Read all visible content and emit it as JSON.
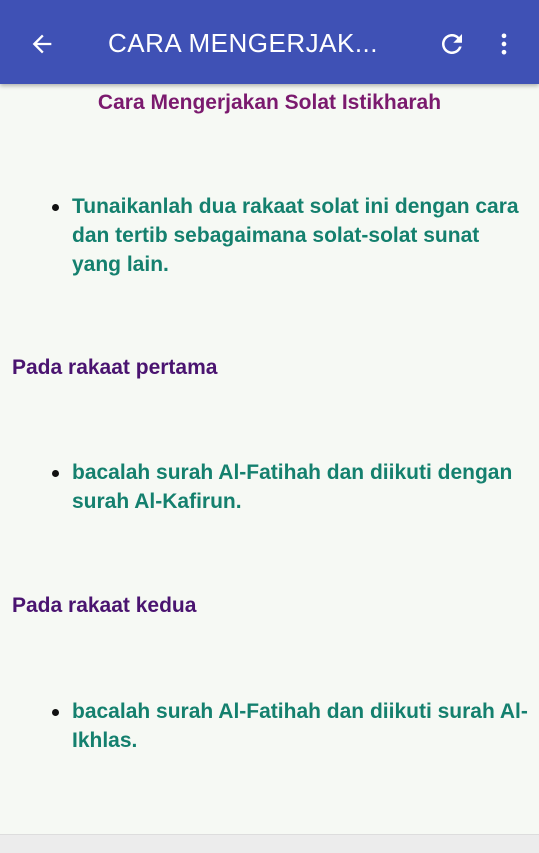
{
  "appbar": {
    "title": "CARA MENGERJAK...",
    "back_icon": "arrow-left-icon",
    "refresh_icon": "refresh-icon",
    "more_icon": "more-vertical-icon",
    "background_color": "#3f51b5"
  },
  "content": {
    "title": "Cara Mengerjakan Solat Istikharah",
    "intro_bullet": "Tunaikanlah dua rakaat solat ini dengan cara dan tertib sebagaimana solat-solat sunat yang lain.",
    "section1": {
      "heading": "Pada rakaat pertama",
      "bullet": "bacalah surah Al-Fatihah dan diikuti dengan surah Al-Kafirun."
    },
    "section2": {
      "heading": "Pada rakaat kedua",
      "bullet": "bacalah surah Al-Fatihah dan diikuti surah Al-Ikhlas."
    }
  },
  "colors": {
    "title_color": "#7b1a6e",
    "bullet_color": "#14806e",
    "heading_color": "#4a1470",
    "page_background": "#f6f9f4"
  }
}
